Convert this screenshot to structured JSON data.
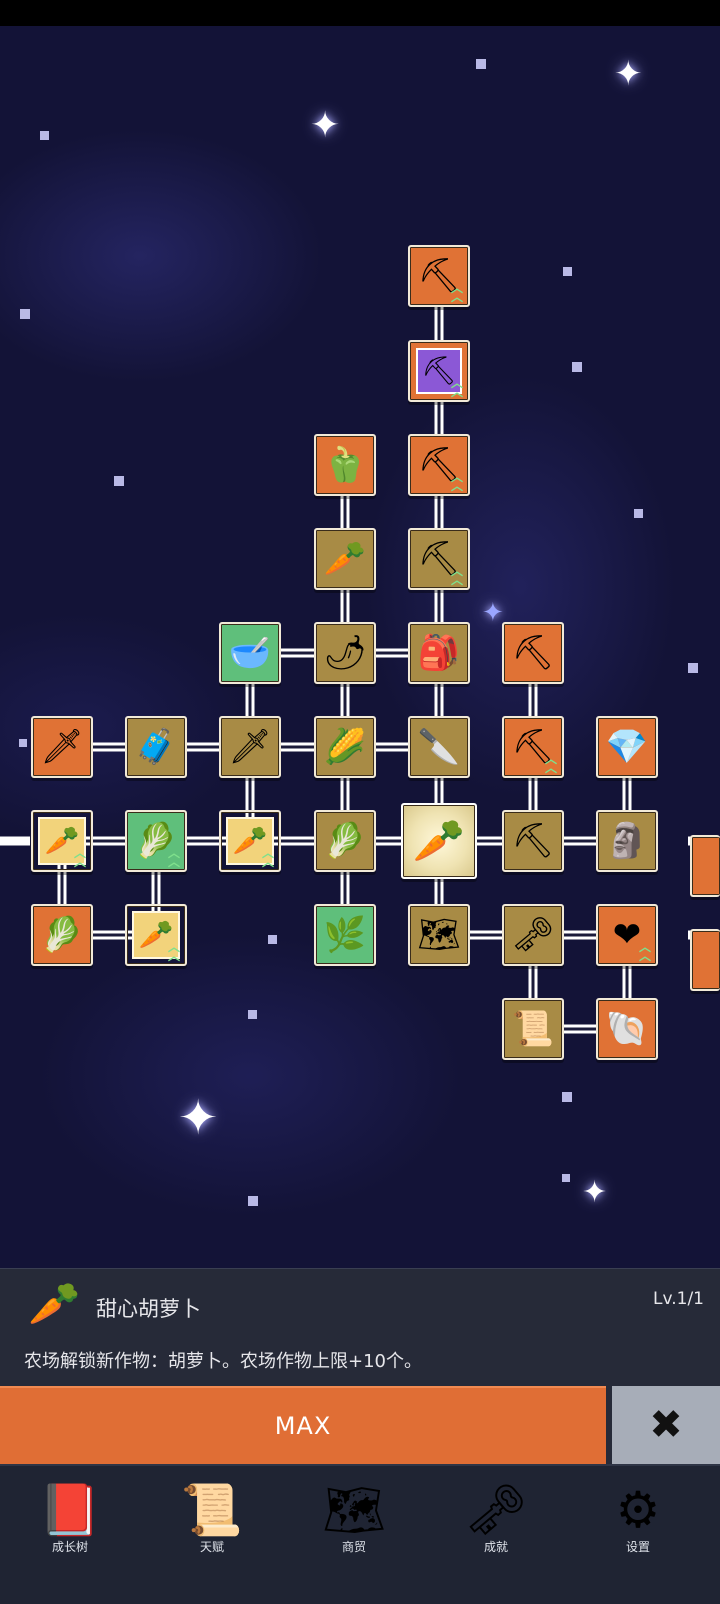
{
  "info_panel": {
    "item_name": "甜心胡萝卜",
    "item_icon": "carrot-icon",
    "level": "Lv.1/1",
    "description": "农场解锁新作物：胡萝卜。农场作物上限+10个。"
  },
  "actions": {
    "max_label": "MAX",
    "close_icon": "close-x-icon"
  },
  "nav": {
    "items": [
      {
        "label": "成长树",
        "icon": "book-icon"
      },
      {
        "label": "天赋",
        "icon": "scroll-icon"
      },
      {
        "label": "商贸",
        "icon": "map-icon"
      },
      {
        "label": "成就",
        "icon": "key-icon"
      },
      {
        "label": "设置",
        "icon": "gear-icon"
      }
    ]
  },
  "skill_tree": {
    "colors": {
      "orange": "#e07235",
      "tan": "#a88b45",
      "green": "#5fbf7b",
      "purple": "#8b58d6",
      "selected": "#efe3b2"
    },
    "nodes": [
      {
        "id": "shovel-1",
        "icon": "shovel-icon",
        "glyph": "⛏",
        "style": "orange",
        "upgrade": true
      },
      {
        "id": "shovel-purple",
        "icon": "shovel-icon",
        "glyph": "⛏",
        "style": "purple",
        "upgrade": true
      },
      {
        "id": "pepper",
        "icon": "bell-pepper-icon",
        "glyph": "🫑",
        "style": "orange",
        "upgrade": false
      },
      {
        "id": "shovel-2",
        "icon": "shovel-icon",
        "glyph": "⛏",
        "style": "orange",
        "upgrade": true
      },
      {
        "id": "radish",
        "icon": "radish-icon",
        "glyph": "🥕",
        "style": "tan",
        "upgrade": false
      },
      {
        "id": "shovel-3",
        "icon": "shovel-icon",
        "glyph": "⛏",
        "style": "tan",
        "upgrade": true
      },
      {
        "id": "bowl",
        "icon": "bowl-icon",
        "glyph": "🥣",
        "style": "green",
        "upgrade": false
      },
      {
        "id": "chili",
        "icon": "chili-icon",
        "glyph": "🌶",
        "style": "tan",
        "upgrade": false
      },
      {
        "id": "bag",
        "icon": "bag-icon",
        "glyph": "🎒",
        "style": "tan",
        "upgrade": false
      },
      {
        "id": "pickaxe-1",
        "icon": "pickaxe-icon",
        "glyph": "⛏",
        "style": "orange",
        "upgrade": false
      },
      {
        "id": "sword-1",
        "icon": "sword-icon",
        "glyph": "🗡",
        "style": "orange",
        "upgrade": false
      },
      {
        "id": "chest",
        "icon": "chest-icon",
        "glyph": "🧳",
        "style": "tan",
        "upgrade": false
      },
      {
        "id": "sword-2",
        "icon": "sword-icon",
        "glyph": "🗡",
        "style": "tan",
        "upgrade": false
      },
      {
        "id": "corn",
        "icon": "corn-icon",
        "glyph": "🌽",
        "style": "tan",
        "upgrade": false
      },
      {
        "id": "knife",
        "icon": "knife-icon",
        "glyph": "🔪",
        "style": "tan",
        "upgrade": false
      },
      {
        "id": "pickaxe-2",
        "icon": "pickaxe-icon",
        "glyph": "⛏",
        "style": "orange",
        "upgrade": true
      },
      {
        "id": "crystal",
        "icon": "crystal-icon",
        "glyph": "💎",
        "style": "orange",
        "upgrade": false
      },
      {
        "id": "carrot-1",
        "icon": "carrot-icon",
        "glyph": "🥕",
        "style": "framed",
        "upgrade": true
      },
      {
        "id": "cabbage-1",
        "icon": "cabbage-icon",
        "glyph": "🥬",
        "style": "green",
        "upgrade": true
      },
      {
        "id": "carrot-2",
        "icon": "carrot-icon",
        "glyph": "🥕",
        "style": "framed",
        "upgrade": true
      },
      {
        "id": "cabbage-2",
        "icon": "cabbage-icon",
        "glyph": "🥬",
        "style": "tan",
        "upgrade": false
      },
      {
        "id": "carrot-center",
        "icon": "carrot-icon",
        "glyph": "🥕",
        "style": "center",
        "upgrade": false
      },
      {
        "id": "pickaxe-3",
        "icon": "pickaxe-icon",
        "glyph": "⛏",
        "style": "tan",
        "upgrade": false
      },
      {
        "id": "statue",
        "icon": "statue-icon",
        "glyph": "🗿",
        "style": "tan",
        "upgrade": false
      },
      {
        "id": "cabbage-3",
        "icon": "cabbage-icon",
        "glyph": "🥬",
        "style": "orange",
        "upgrade": false
      },
      {
        "id": "carrot-3",
        "icon": "carrot-icon",
        "glyph": "🥕",
        "style": "framed",
        "upgrade": true
      },
      {
        "id": "root",
        "icon": "root-icon",
        "glyph": "🌿",
        "style": "green",
        "upgrade": false
      },
      {
        "id": "map",
        "icon": "map-icon",
        "glyph": "🗺",
        "style": "tan",
        "upgrade": false
      },
      {
        "id": "key",
        "icon": "key-icon",
        "glyph": "🗝",
        "style": "tan",
        "upgrade": false
      },
      {
        "id": "heart",
        "icon": "heart-icon",
        "glyph": "❤",
        "style": "orange",
        "upgrade": true
      },
      {
        "id": "scroll",
        "icon": "scroll-icon",
        "glyph": "📜",
        "style": "tan",
        "upgrade": false
      },
      {
        "id": "fossil",
        "icon": "fossil-icon",
        "glyph": "🐚",
        "style": "orange",
        "upgrade": false
      }
    ]
  }
}
